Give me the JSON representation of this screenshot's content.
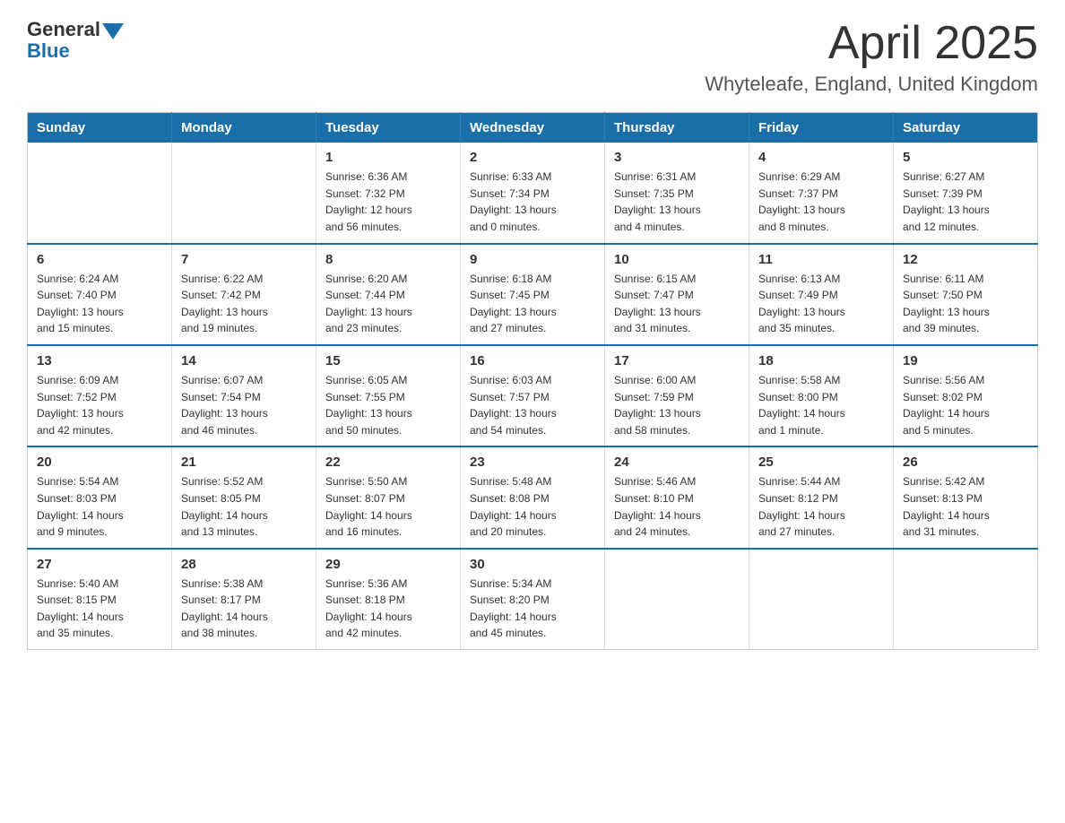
{
  "header": {
    "logo_general": "General",
    "logo_blue": "Blue",
    "title": "April 2025",
    "subtitle": "Whyteleafe, England, United Kingdom"
  },
  "calendar": {
    "days_of_week": [
      "Sunday",
      "Monday",
      "Tuesday",
      "Wednesday",
      "Thursday",
      "Friday",
      "Saturday"
    ],
    "weeks": [
      [
        {
          "day": "",
          "info": ""
        },
        {
          "day": "",
          "info": ""
        },
        {
          "day": "1",
          "info": "Sunrise: 6:36 AM\nSunset: 7:32 PM\nDaylight: 12 hours\nand 56 minutes."
        },
        {
          "day": "2",
          "info": "Sunrise: 6:33 AM\nSunset: 7:34 PM\nDaylight: 13 hours\nand 0 minutes."
        },
        {
          "day": "3",
          "info": "Sunrise: 6:31 AM\nSunset: 7:35 PM\nDaylight: 13 hours\nand 4 minutes."
        },
        {
          "day": "4",
          "info": "Sunrise: 6:29 AM\nSunset: 7:37 PM\nDaylight: 13 hours\nand 8 minutes."
        },
        {
          "day": "5",
          "info": "Sunrise: 6:27 AM\nSunset: 7:39 PM\nDaylight: 13 hours\nand 12 minutes."
        }
      ],
      [
        {
          "day": "6",
          "info": "Sunrise: 6:24 AM\nSunset: 7:40 PM\nDaylight: 13 hours\nand 15 minutes."
        },
        {
          "day": "7",
          "info": "Sunrise: 6:22 AM\nSunset: 7:42 PM\nDaylight: 13 hours\nand 19 minutes."
        },
        {
          "day": "8",
          "info": "Sunrise: 6:20 AM\nSunset: 7:44 PM\nDaylight: 13 hours\nand 23 minutes."
        },
        {
          "day": "9",
          "info": "Sunrise: 6:18 AM\nSunset: 7:45 PM\nDaylight: 13 hours\nand 27 minutes."
        },
        {
          "day": "10",
          "info": "Sunrise: 6:15 AM\nSunset: 7:47 PM\nDaylight: 13 hours\nand 31 minutes."
        },
        {
          "day": "11",
          "info": "Sunrise: 6:13 AM\nSunset: 7:49 PM\nDaylight: 13 hours\nand 35 minutes."
        },
        {
          "day": "12",
          "info": "Sunrise: 6:11 AM\nSunset: 7:50 PM\nDaylight: 13 hours\nand 39 minutes."
        }
      ],
      [
        {
          "day": "13",
          "info": "Sunrise: 6:09 AM\nSunset: 7:52 PM\nDaylight: 13 hours\nand 42 minutes."
        },
        {
          "day": "14",
          "info": "Sunrise: 6:07 AM\nSunset: 7:54 PM\nDaylight: 13 hours\nand 46 minutes."
        },
        {
          "day": "15",
          "info": "Sunrise: 6:05 AM\nSunset: 7:55 PM\nDaylight: 13 hours\nand 50 minutes."
        },
        {
          "day": "16",
          "info": "Sunrise: 6:03 AM\nSunset: 7:57 PM\nDaylight: 13 hours\nand 54 minutes."
        },
        {
          "day": "17",
          "info": "Sunrise: 6:00 AM\nSunset: 7:59 PM\nDaylight: 13 hours\nand 58 minutes."
        },
        {
          "day": "18",
          "info": "Sunrise: 5:58 AM\nSunset: 8:00 PM\nDaylight: 14 hours\nand 1 minute."
        },
        {
          "day": "19",
          "info": "Sunrise: 5:56 AM\nSunset: 8:02 PM\nDaylight: 14 hours\nand 5 minutes."
        }
      ],
      [
        {
          "day": "20",
          "info": "Sunrise: 5:54 AM\nSunset: 8:03 PM\nDaylight: 14 hours\nand 9 minutes."
        },
        {
          "day": "21",
          "info": "Sunrise: 5:52 AM\nSunset: 8:05 PM\nDaylight: 14 hours\nand 13 minutes."
        },
        {
          "day": "22",
          "info": "Sunrise: 5:50 AM\nSunset: 8:07 PM\nDaylight: 14 hours\nand 16 minutes."
        },
        {
          "day": "23",
          "info": "Sunrise: 5:48 AM\nSunset: 8:08 PM\nDaylight: 14 hours\nand 20 minutes."
        },
        {
          "day": "24",
          "info": "Sunrise: 5:46 AM\nSunset: 8:10 PM\nDaylight: 14 hours\nand 24 minutes."
        },
        {
          "day": "25",
          "info": "Sunrise: 5:44 AM\nSunset: 8:12 PM\nDaylight: 14 hours\nand 27 minutes."
        },
        {
          "day": "26",
          "info": "Sunrise: 5:42 AM\nSunset: 8:13 PM\nDaylight: 14 hours\nand 31 minutes."
        }
      ],
      [
        {
          "day": "27",
          "info": "Sunrise: 5:40 AM\nSunset: 8:15 PM\nDaylight: 14 hours\nand 35 minutes."
        },
        {
          "day": "28",
          "info": "Sunrise: 5:38 AM\nSunset: 8:17 PM\nDaylight: 14 hours\nand 38 minutes."
        },
        {
          "day": "29",
          "info": "Sunrise: 5:36 AM\nSunset: 8:18 PM\nDaylight: 14 hours\nand 42 minutes."
        },
        {
          "day": "30",
          "info": "Sunrise: 5:34 AM\nSunset: 8:20 PM\nDaylight: 14 hours\nand 45 minutes."
        },
        {
          "day": "",
          "info": ""
        },
        {
          "day": "",
          "info": ""
        },
        {
          "day": "",
          "info": ""
        }
      ]
    ]
  }
}
